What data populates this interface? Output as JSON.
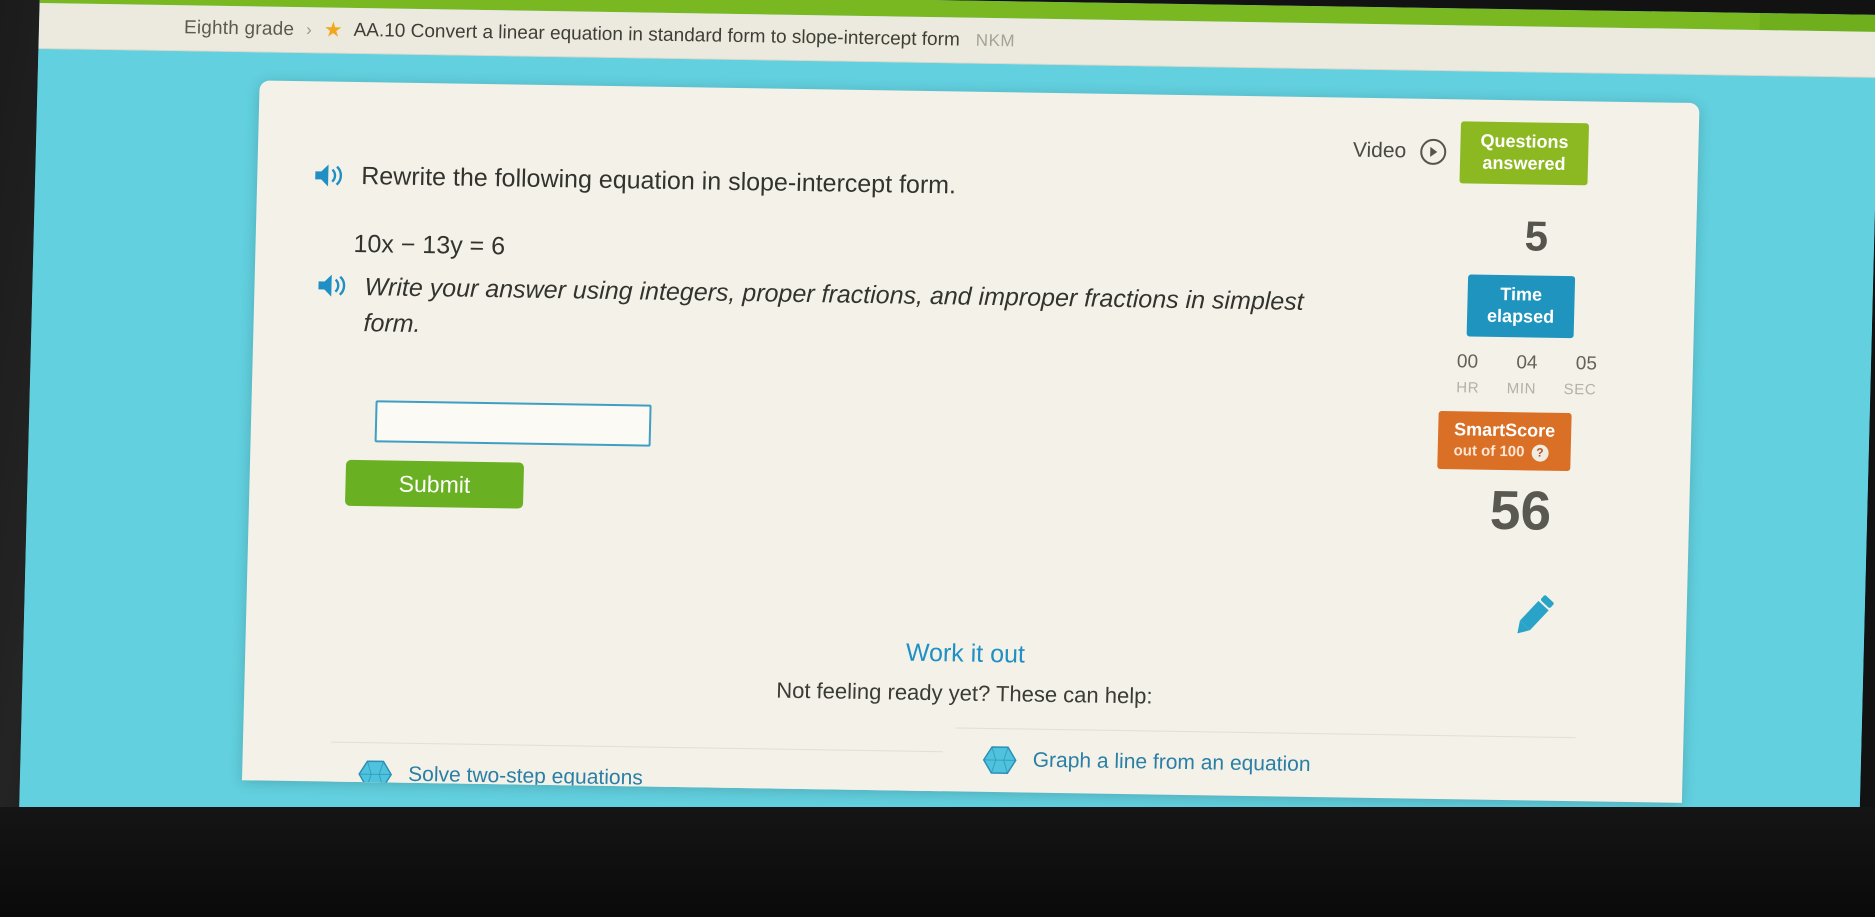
{
  "breadcrumb": {
    "grade": "Eighth grade",
    "separator": "›",
    "star_icon": "star-icon",
    "skill": "AA.10 Convert a linear equation in standard form to slope-intercept form",
    "code": "NKM"
  },
  "video": {
    "label": "Video",
    "play_icon": "play-circle-icon"
  },
  "questions_answered": {
    "badge_line1": "Questions",
    "badge_line2": "answered",
    "count": "5",
    "color": "#8cb821"
  },
  "time_elapsed": {
    "badge_line1": "Time",
    "badge_line2": "elapsed",
    "hr": "00",
    "min": "04",
    "sec": "05",
    "hr_label": "HR",
    "min_label": "MIN",
    "sec_label": "SEC",
    "color": "#1f94bf"
  },
  "smartscore": {
    "title": "SmartScore",
    "subtitle": "out of 100",
    "help_icon": "?",
    "value": "56",
    "color": "#da6f26"
  },
  "pencil_icon": "pencil-icon",
  "question": {
    "speaker_icon": "speaker-icon",
    "prompt": "Rewrite the following equation in slope-intercept form.",
    "equation": {
      "lhs_coef1": "10",
      "var1": "x",
      "operator": "−",
      "lhs_coef2": "13",
      "var2": "y",
      "equals": "=",
      "rhs": "6",
      "full": "10x − 13y = 6"
    },
    "instruction": "Write your answer using integers, proper fractions, and improper fractions in simplest form.",
    "answer_value": "",
    "answer_placeholder": "",
    "submit_label": "Submit"
  },
  "work_it_out": {
    "title": "Work it out",
    "subtitle": "Not feeling ready yet? These can help:",
    "links": [
      {
        "label": "Solve two-step equations",
        "icon": "diamond-skill-icon"
      },
      {
        "label": "Graph a line from an equation",
        "icon": "diamond-skill-icon"
      }
    ]
  },
  "theme": {
    "topbar_green": "#7ab822",
    "page_cyan": "#62d0df",
    "card_cream": "#f3f1e8",
    "link_blue": "#2a7fa6",
    "submit_green": "#6ab023"
  }
}
